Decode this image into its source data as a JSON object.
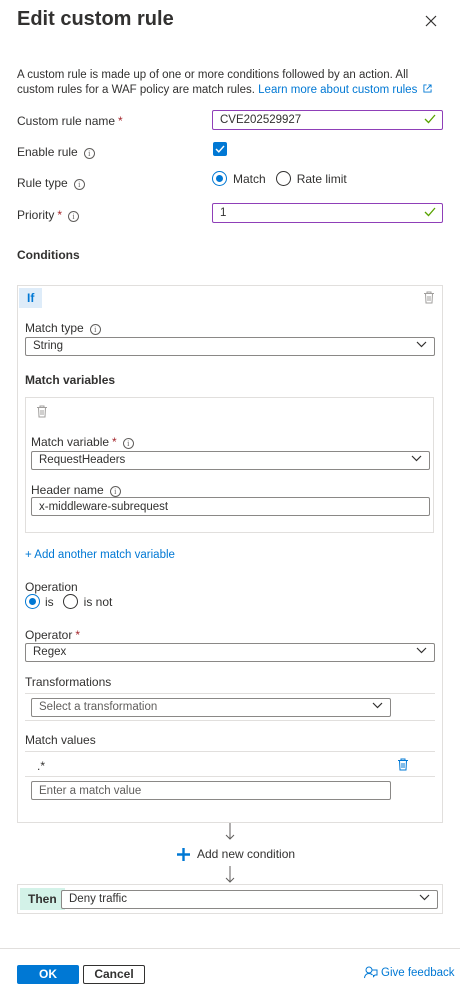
{
  "panel": {
    "title": "Edit custom rule",
    "description": "A custom rule is made up of one or more conditions followed by an action. All custom rules for a WAF policy are match rules.",
    "learn_more": "Learn more about custom rules"
  },
  "form": {
    "custom_rule_name": {
      "label": "Custom rule name",
      "value": "CVE202529927"
    },
    "enable_rule": {
      "label": "Enable rule",
      "checked": true
    },
    "rule_type": {
      "label": "Rule type",
      "options": [
        "Match",
        "Rate limit"
      ],
      "selected": "Match"
    },
    "priority": {
      "label": "Priority",
      "value": "1"
    }
  },
  "conditions": {
    "title": "Conditions",
    "if_label": "If",
    "match_type": {
      "label": "Match type",
      "value": "String"
    },
    "match_variables": {
      "title": "Match variables",
      "match_variable": {
        "label": "Match variable",
        "value": "RequestHeaders"
      },
      "header_name": {
        "label": "Header name",
        "value": "x-middleware-subrequest"
      },
      "add_link": "+ Add another match variable"
    },
    "operation": {
      "label": "Operation",
      "options": [
        "is",
        "is not"
      ],
      "selected": "is"
    },
    "operator": {
      "label": "Operator",
      "value": "Regex"
    },
    "transformations": {
      "label": "Transformations",
      "placeholder": "Select a transformation"
    },
    "match_values": {
      "label": "Match values",
      "values": [
        ".*"
      ],
      "placeholder": "Enter a match value"
    },
    "add_condition": "Add new condition"
  },
  "then": {
    "label": "Then",
    "value": "Deny traffic"
  },
  "footer": {
    "ok": "OK",
    "cancel": "Cancel",
    "feedback": "Give feedback"
  },
  "colors": {
    "accent": "#0078d4",
    "valid_border": "#8f3fb8",
    "valid_check": "#57a300",
    "required": "#a4262c"
  }
}
